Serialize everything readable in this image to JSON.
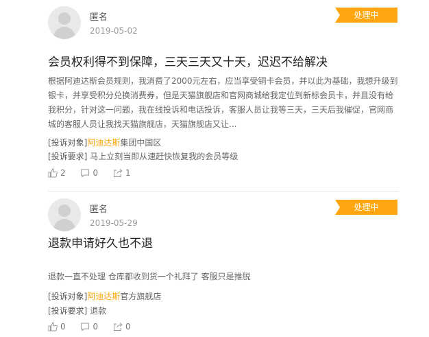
{
  "complaints": [
    {
      "user": "匿名",
      "date": "2019-05-02",
      "status": "处理中",
      "title": "会员权利得不到保障，三天三天又十天，迟迟不给解决",
      "description": "根据阿迪达斯会员规则，我消费了2000元左右，应当享受铜卡会员，并以此为基础，我想升级到银卡，并享受积分兑换消费券，但是天猫旗舰店和官网商城给我定位到新标会员卡，并且没有给我积分，针对这一问题，我在线投诉和电话投诉，客服人员让我等三天，三天后我催促，官网商城的客服人员让我找天猫旗舰店，天猫旗舰店又让...",
      "target_label": "[投诉对象]",
      "target_brand": "阿迪达斯",
      "target_rest": "集团中国区",
      "request_label": "[投诉要求]",
      "request": "马上立刻当即从速赶快恢复我的会员等级",
      "likes": "2",
      "comments": "0",
      "shares": "1"
    },
    {
      "user": "匿名",
      "date": "2019-05-29",
      "status": "处理中",
      "title": "退款申请好久也不退",
      "description": "退款一直不处理 仓库都收到货一个礼拜了 客服只是推脱",
      "target_label": "[投诉对象]",
      "target_brand": "阿迪达斯",
      "target_rest": "官方旗舰店",
      "request_label": "[投诉要求]",
      "request": "退款",
      "likes": "0",
      "comments": "0",
      "shares": "0"
    }
  ],
  "colors": {
    "accent": "#ffa611",
    "divider": "#e6e6e6"
  }
}
